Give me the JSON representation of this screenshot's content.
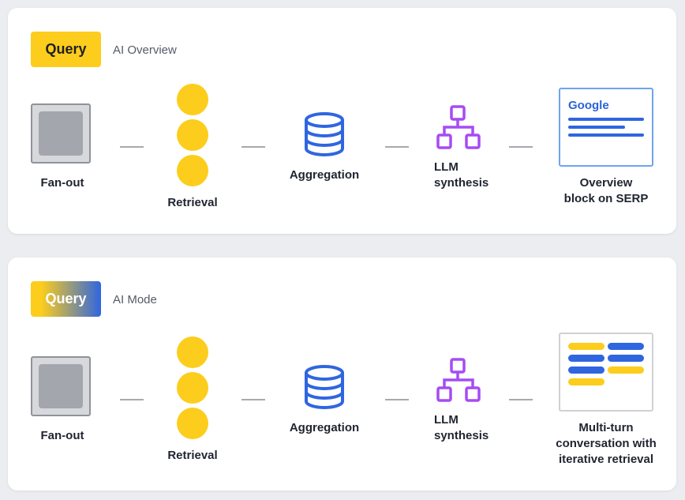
{
  "colors": {
    "background": "#ecedf0",
    "card": "#ffffff",
    "yellow": "#fccd1c",
    "blue": "#2f66e0",
    "purple": "#a64bf4",
    "gray_box": "#a3a7ad",
    "connector": "#a7a9ae"
  },
  "panels": [
    {
      "query_label": "Query",
      "mode_label": "AI Overview",
      "steps": {
        "fanout": "Fan-out",
        "retrieval": "Retrieval",
        "aggregation": "Aggregation",
        "llm_line1": "LLM",
        "llm_line2": "synthesis",
        "output_line1": "Overview",
        "output_line2": "block on SERP"
      },
      "serp_brand": "Google",
      "icons": [
        "fanout-box-icon",
        "retrieval-dots-icon",
        "database-icon",
        "hierarchy-icon",
        "serp-block-icon"
      ]
    },
    {
      "query_label": "Query",
      "mode_label": "AI Mode",
      "steps": {
        "fanout": "Fan-out",
        "retrieval": "Retrieval",
        "aggregation": "Aggregation",
        "llm_line1": "LLM",
        "llm_line2": "synthesis",
        "output_line1": "Multi-turn",
        "output_line2": "conversation with",
        "output_line3": "iterative retrieval"
      },
      "icons": [
        "fanout-box-icon",
        "retrieval-dots-icon",
        "database-icon",
        "hierarchy-icon",
        "conversation-icon"
      ]
    }
  ]
}
